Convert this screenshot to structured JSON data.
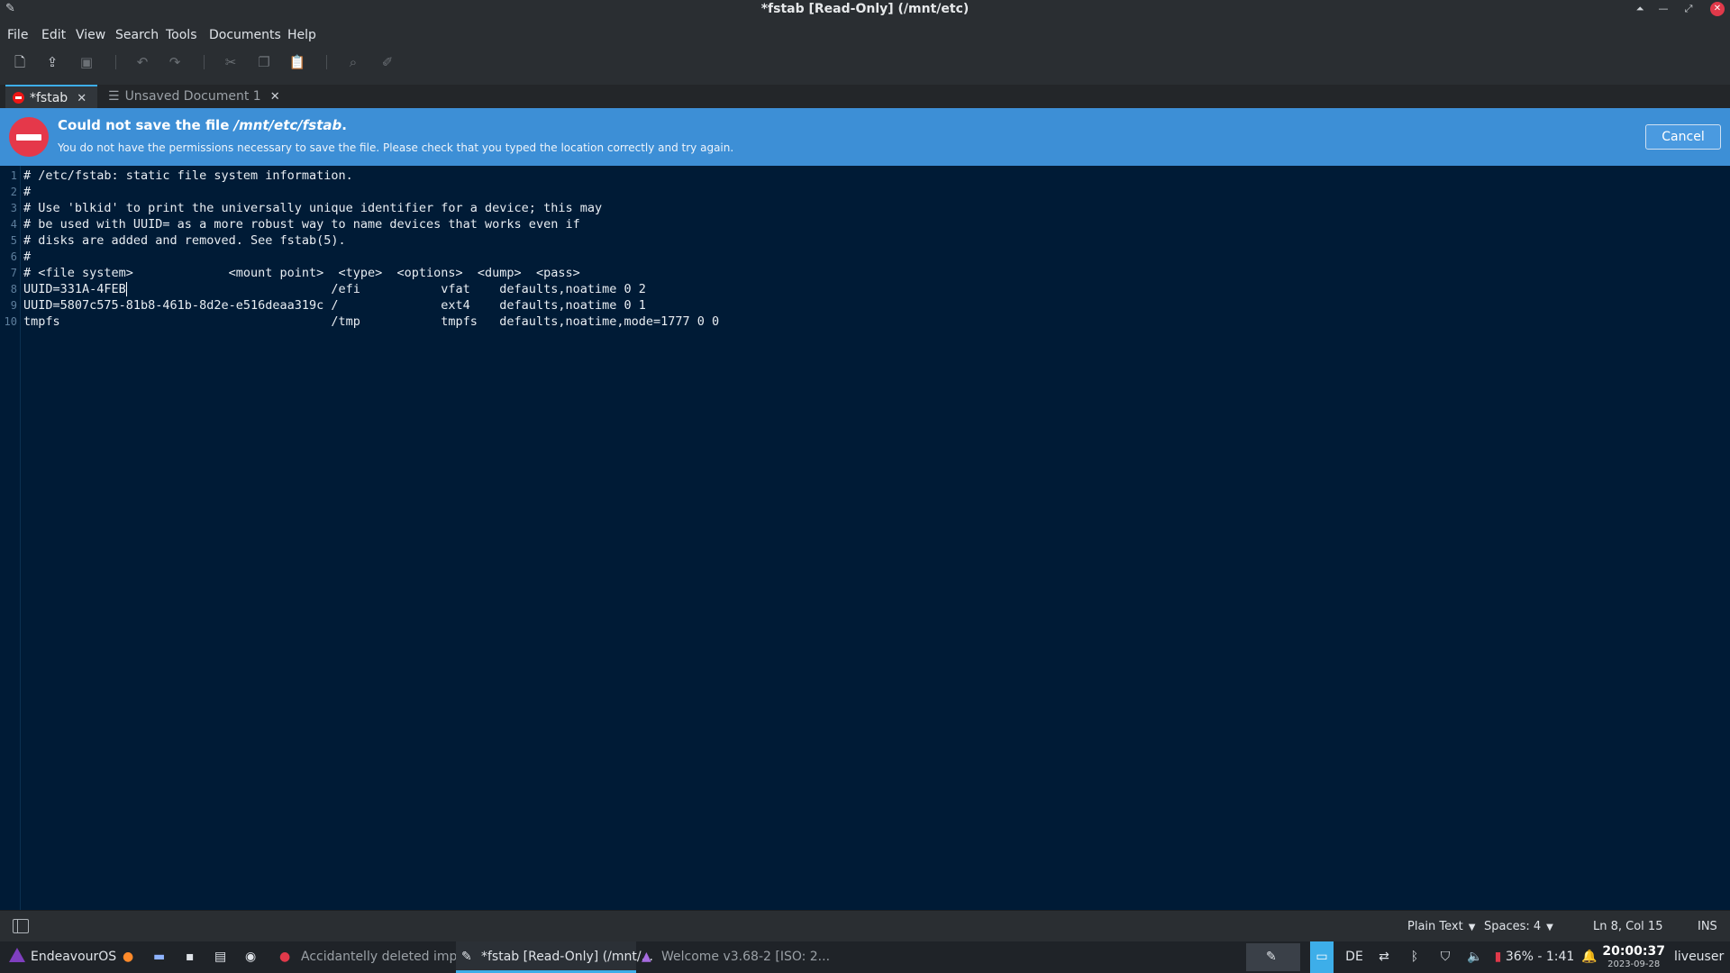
{
  "window": {
    "title": "*fstab [Read-Only] (/mnt/etc)",
    "app_icon": "text-editor-icon"
  },
  "menu": [
    "File",
    "Edit",
    "View",
    "Search",
    "Tools",
    "Documents",
    "Help"
  ],
  "tabs": [
    {
      "label": "*fstab",
      "icon": "error-stop-icon",
      "active": true
    },
    {
      "label": "Unsaved Document 1",
      "icon": "document-lines-icon",
      "active": false
    }
  ],
  "infobar": {
    "title_prefix": "Could not save the file ",
    "title_path": "/mnt/etc/fstab",
    "title_suffix": ".",
    "message": "You do not have the permissions necessary to save the file. Please check that you typed the location correctly and try again.",
    "cancel_label": "Cancel",
    "color": "#3d8fd6"
  },
  "editor": {
    "lines": [
      "# /etc/fstab: static file system information.",
      "#",
      "# Use 'blkid' to print the universally unique identifier for a device; this may",
      "# be used with UUID= as a more robust way to name devices that works even if",
      "# disks are added and removed. See fstab(5).",
      "#",
      "# <file system>             <mount point>  <type>  <options>  <dump>  <pass>",
      "UUID=331A-4FEB                            /efi           vfat    defaults,noatime 0 2",
      "UUID=5807c575-81b8-461b-8d2e-e516deaa319c /              ext4    defaults,noatime 0 1",
      "tmpfs                                     /tmp           tmpfs   defaults,noatime,mode=1777 0 0"
    ],
    "line_numbers": [
      "1",
      "2",
      "3",
      "4",
      "5",
      "6",
      "7",
      "8",
      "9",
      "10"
    ],
    "cursor_line": 8,
    "cursor_col": 15
  },
  "statusbar": {
    "language": "Plain Text",
    "indent": "Spaces: 4",
    "position": "Ln 8, Col 15",
    "mode": "INS"
  },
  "taskbar": {
    "menu_label": "EndeavourOS",
    "tasks": [
      {
        "label": "Accidantelly deleted imp...",
        "active": false
      },
      {
        "label": "*fstab [Read-Only] (/mnt/...",
        "active": true
      },
      {
        "label": "Welcome v3.68-2  [ISO: 2...",
        "active": false
      }
    ],
    "keyboard_layout": "DE",
    "battery": "36% - 1:41",
    "clock_time": "20:00:37",
    "clock_date": "2023-09-28",
    "user": "liveuser"
  }
}
